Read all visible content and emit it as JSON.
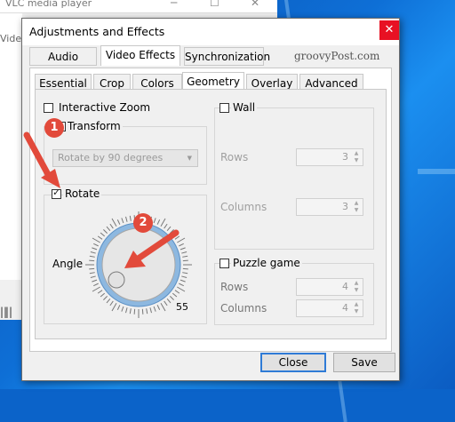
{
  "vlc": {
    "title": "VLC media player",
    "video_label": "Video"
  },
  "dialog": {
    "title": "Adjustments and Effects",
    "close_glyph": "✕",
    "watermark": "groovyPost.com",
    "main_tabs": [
      {
        "label": "Audio Effects",
        "active": false
      },
      {
        "label": "Video Effects",
        "active": true
      },
      {
        "label": "Synchronization",
        "active": false
      }
    ],
    "sub_tabs": [
      {
        "label": "Essential",
        "active": false
      },
      {
        "label": "Crop",
        "active": false
      },
      {
        "label": "Colors",
        "active": false
      },
      {
        "label": "Geometry",
        "active": true
      },
      {
        "label": "Overlay",
        "active": false
      },
      {
        "label": "Advanced",
        "active": false
      }
    ],
    "geometry": {
      "interactive_zoom": {
        "label": "Interactive Zoom",
        "checked": false
      },
      "transform": {
        "label": "Transform",
        "checked": false,
        "dropdown_value": "Rotate by 90 degrees"
      },
      "rotate": {
        "label": "Rotate",
        "checked": true,
        "angle_label": "Angle",
        "angle_value": "55"
      },
      "wall": {
        "label": "Wall",
        "checked": false,
        "rows_label": "Rows",
        "rows_value": "3",
        "columns_label": "Columns",
        "columns_value": "3"
      },
      "puzzle": {
        "label": "Puzzle game",
        "checked": false,
        "rows_label": "Rows",
        "rows_value": "4",
        "columns_label": "Columns",
        "columns_value": "4"
      }
    },
    "buttons": {
      "close": "Close",
      "save": "Save"
    },
    "callouts": [
      "1",
      "2"
    ],
    "colors": {
      "accent": "#2f7bd6",
      "callout": "#e24a3b",
      "close_bg": "#e81123"
    }
  }
}
